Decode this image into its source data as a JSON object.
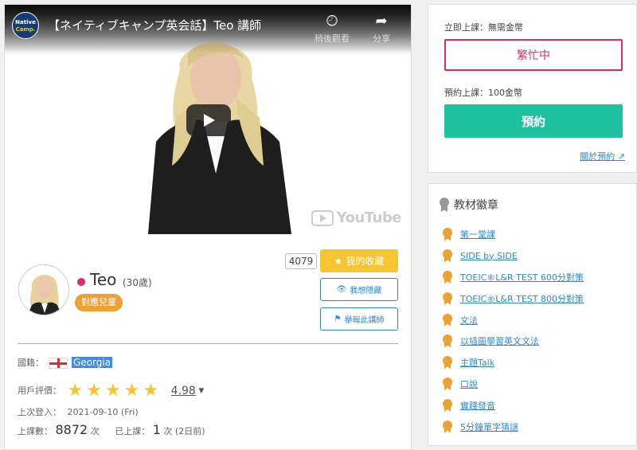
{
  "video": {
    "channel_logo_line1": "Native",
    "channel_logo_line2": "Camp.",
    "title": "【ネイティブキャンプ英会話】Teo 講師",
    "watch_later_label": "稍後觀看",
    "share_label": "分享",
    "youtube_logo": "YouTube"
  },
  "teacher": {
    "name": "Teo",
    "age": "(30歲)",
    "kids_badge": "對應兒童",
    "favorite_count": "4079",
    "favorite_button": "我的收藏",
    "hide_button": "我想隱藏",
    "report_button": "舉報此講師",
    "status_color": "#e6295f"
  },
  "info": {
    "country_label": "國籍：",
    "country_value": "Georgia",
    "rating_label": "用戶評價：",
    "rating_value": "4.98",
    "rating_stars": 5,
    "last_login_label": "上次登入：",
    "last_login_value": "2021-09-10 (Fri)",
    "lessons_label": "上課數：",
    "lessons_value": "8872",
    "lessons_unit": "次",
    "taken_label": "已上課：",
    "taken_value": "1",
    "taken_unit": "次",
    "taken_ago": "(2日前)"
  },
  "booking": {
    "instant_label": "立即上課：無需金幣",
    "busy_button": "繁忙中",
    "reserve_label": "預約上課：100金幣",
    "reserve_button": "預約",
    "about_link": "關於預約"
  },
  "badges": {
    "title": "教材徽章",
    "items": [
      "第一堂課",
      "SIDE by SIDE",
      "TOEIC®L&R TEST 600分對策",
      "TOEIC®L&R TEST 800分對策",
      "文法",
      "以插圖學習英文文法",
      "主題Talk",
      "口說",
      "實踐發音",
      "5分鐘單字猜謎"
    ]
  },
  "colors": {
    "accent_pink": "#e6295f",
    "accent_green": "#1ec2a0",
    "star_yellow": "#f7c531",
    "badge_orange": "#f0a030",
    "link_blue": "#2a8ad6"
  }
}
